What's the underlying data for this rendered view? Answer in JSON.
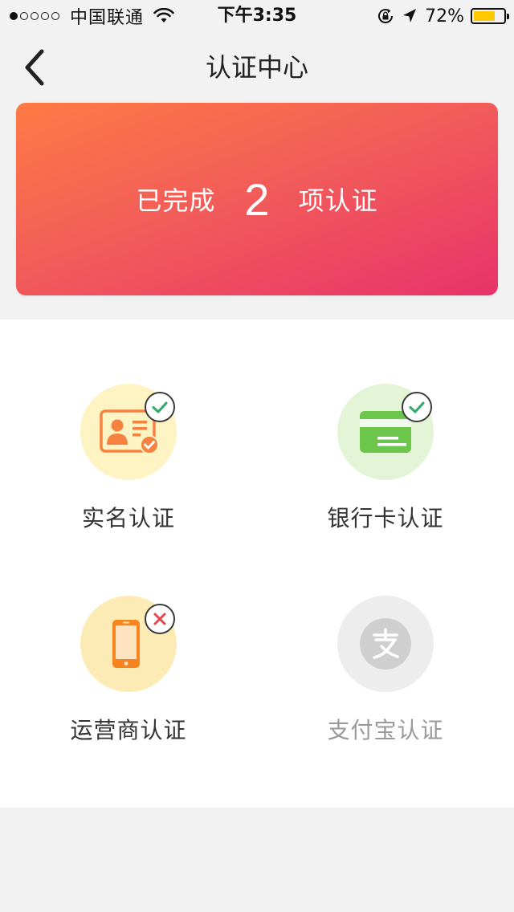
{
  "status_bar": {
    "carrier": "中国联通",
    "time": "下午3:35",
    "battery_percent": "72%",
    "battery_level": 0.72,
    "battery_color": "#ffc800"
  },
  "nav": {
    "title": "认证中心",
    "back_icon": "chevron-left-icon"
  },
  "banner": {
    "prefix": "已完成",
    "count": "2",
    "suffix": "项认证",
    "gradient": [
      "#ff7a45",
      "#e8336a"
    ]
  },
  "auth_items": [
    {
      "label": "实名认证",
      "icon": "id-card-icon",
      "status": "verified",
      "circle_color": "#fef4c3",
      "accent": "#f7813f"
    },
    {
      "label": "银行卡认证",
      "icon": "bank-card-icon",
      "status": "verified",
      "circle_color": "#e3f5d6",
      "accent": "#6cc64b"
    },
    {
      "label": "运营商认证",
      "icon": "phone-icon",
      "status": "failed",
      "circle_color": "#fdebb5",
      "accent": "#f7841f"
    },
    {
      "label": "支付宝认证",
      "icon": "alipay-icon",
      "status": "disabled",
      "circle_color": "#ededed",
      "accent": "#cfcfcf"
    }
  ]
}
